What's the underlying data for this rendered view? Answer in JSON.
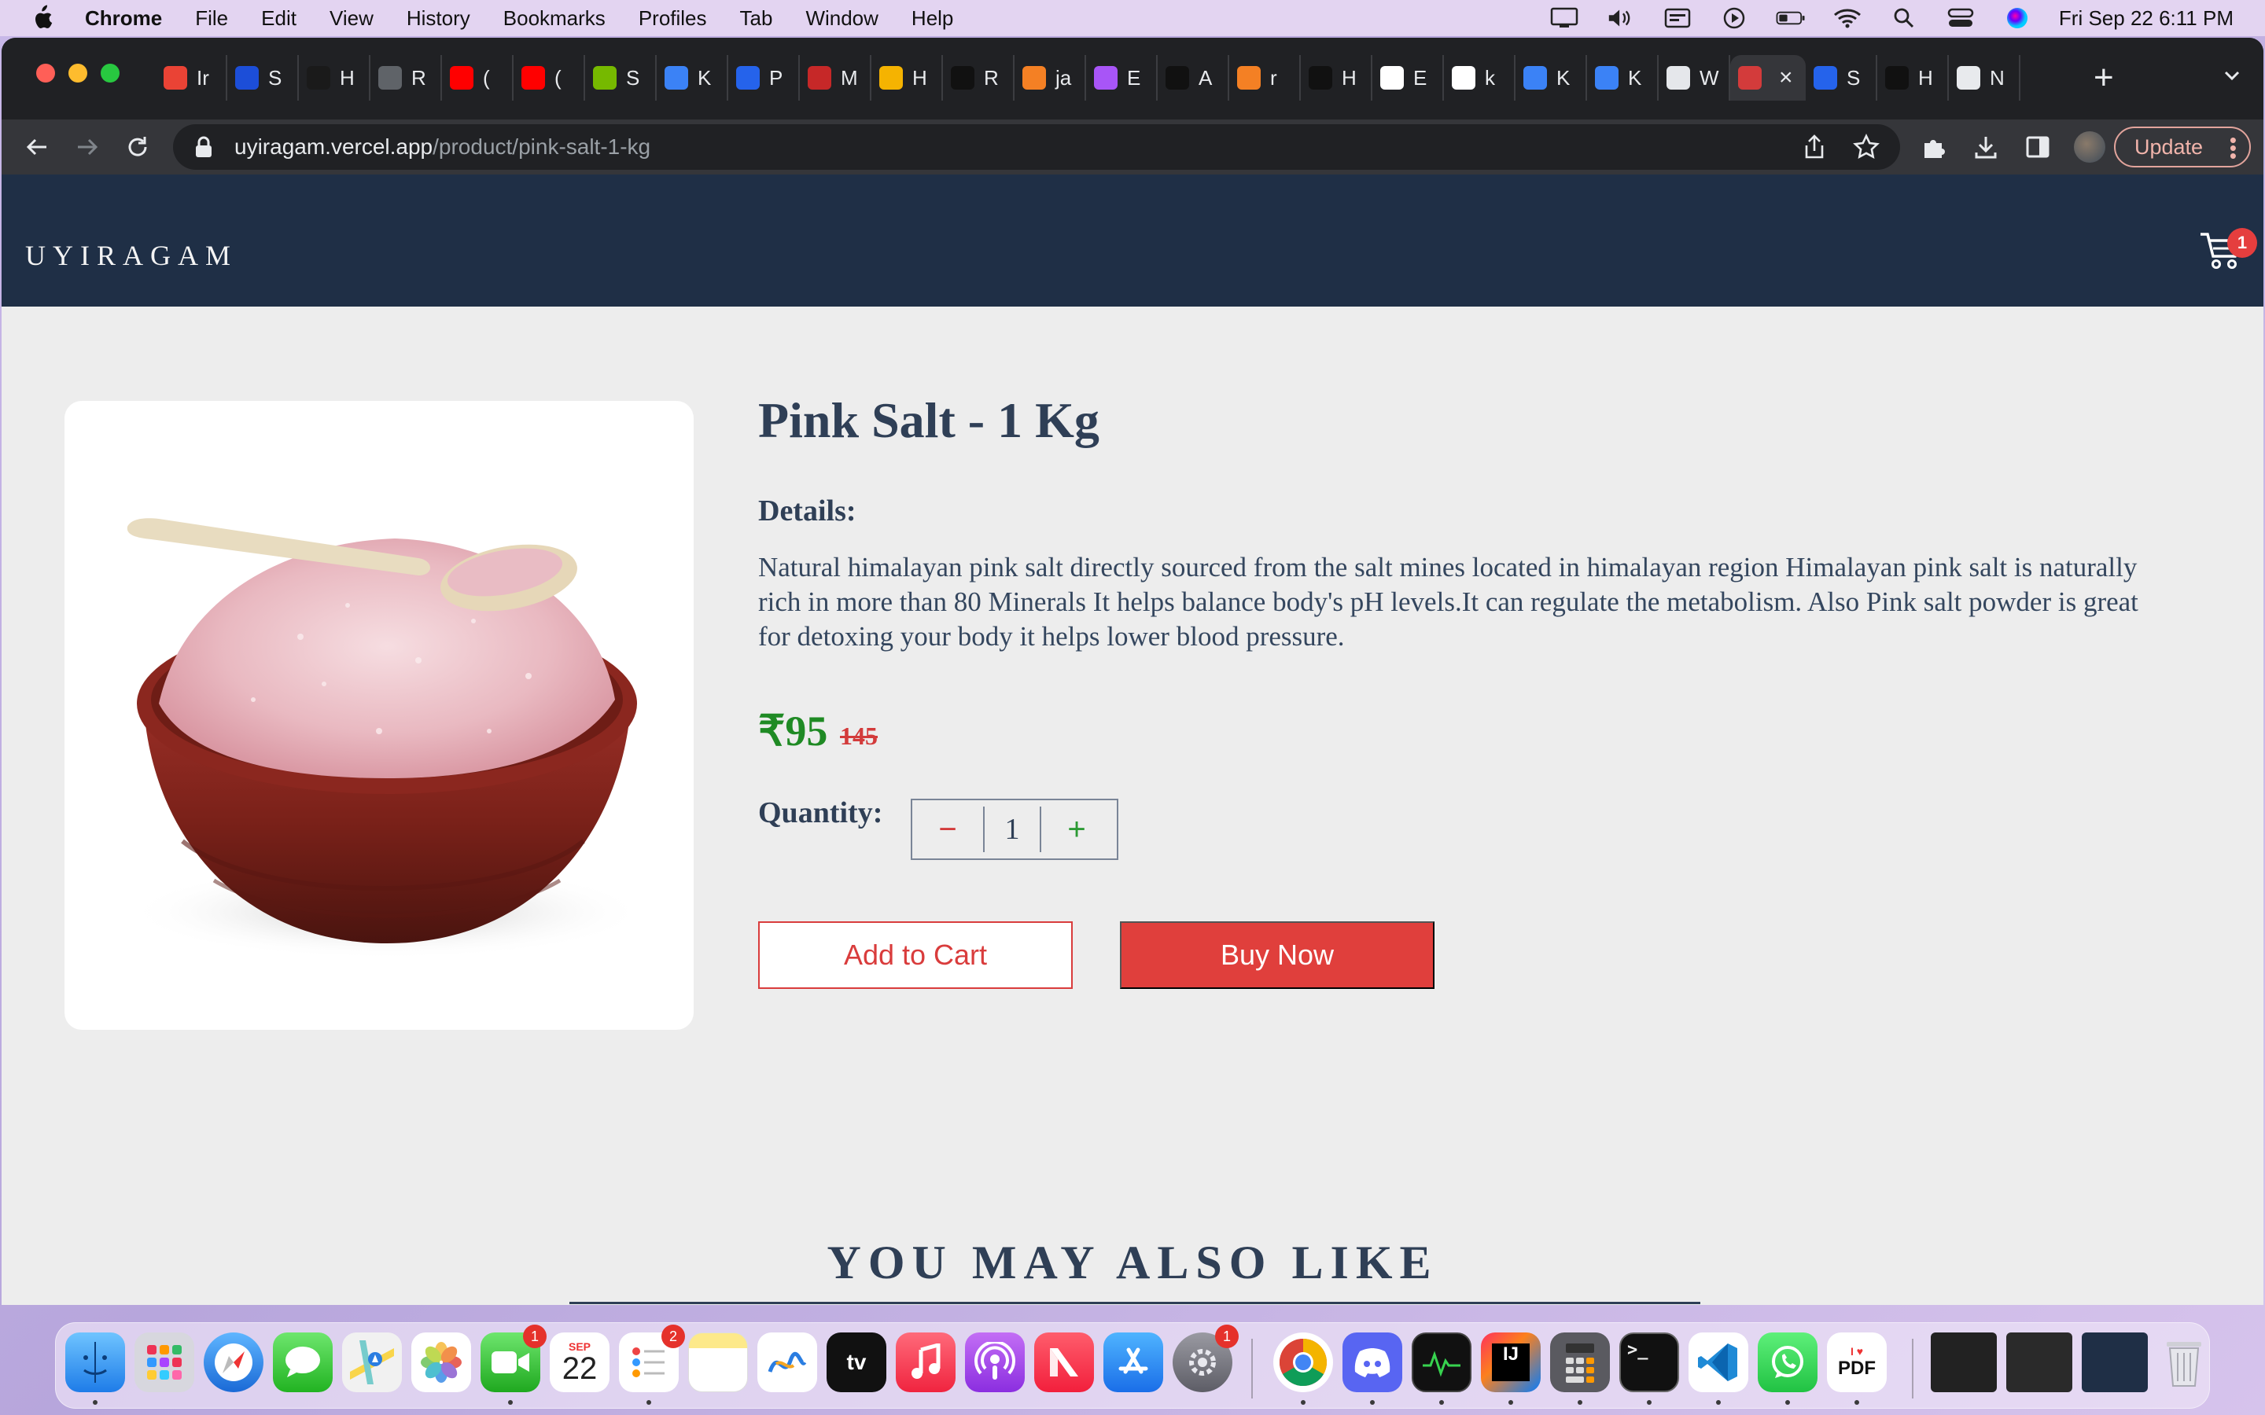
{
  "menubar": {
    "app_name": "Chrome",
    "items": [
      "File",
      "Edit",
      "View",
      "History",
      "Bookmarks",
      "Profiles",
      "Tab",
      "Window",
      "Help"
    ],
    "clock": "Fri Sep 22  6:11 PM"
  },
  "browser": {
    "tabs": [
      {
        "letter": "Ir",
        "icon": "gmail-icon",
        "color": "#ea4335"
      },
      {
        "letter": "S",
        "icon": "unstop-icon",
        "color": "#1c4ed8"
      },
      {
        "letter": "H",
        "icon": "hackerearth-icon",
        "color": "#1a1a1a"
      },
      {
        "letter": "R",
        "icon": "globe-icon",
        "color": "#5f6368"
      },
      {
        "letter": "(",
        "icon": "youtube-icon",
        "color": "#ff0000"
      },
      {
        "letter": "(",
        "icon": "youtube-icon",
        "color": "#ff0000"
      },
      {
        "letter": "S",
        "icon": "nvidia-icon",
        "color": "#76b900"
      },
      {
        "letter": "K",
        "icon": "wave-icon",
        "color": "#3b82f6"
      },
      {
        "letter": "P",
        "icon": "play-icon",
        "color": "#2563eb"
      },
      {
        "letter": "M",
        "icon": "m-icon",
        "color": "#c62828"
      },
      {
        "letter": "H",
        "icon": "smiley-icon",
        "color": "#f5b301"
      },
      {
        "letter": "R",
        "icon": "dumbbell-icon",
        "color": "#111111"
      },
      {
        "letter": "ja",
        "icon": "stackoverflow-icon",
        "color": "#f48024"
      },
      {
        "letter": "E",
        "icon": "vite-icon",
        "color": "#a855f7"
      },
      {
        "letter": "A",
        "icon": "triangle-icon",
        "color": "#111111"
      },
      {
        "letter": "r",
        "icon": "stackoverflow-icon",
        "color": "#f48024"
      },
      {
        "letter": "H",
        "icon": "medium-icon",
        "color": "#111111"
      },
      {
        "letter": "E",
        "icon": "w3schools-icon",
        "color": "#ffffff"
      },
      {
        "letter": "k",
        "icon": "github-icon",
        "color": "#ffffff"
      },
      {
        "letter": "K",
        "icon": "wave-icon",
        "color": "#3b82f6"
      },
      {
        "letter": "K",
        "icon": "wave-icon",
        "color": "#3b82f6"
      },
      {
        "letter": "W",
        "icon": "wellfound-icon",
        "color": "#e5e7eb"
      },
      {
        "letter": "",
        "icon": "uyiragam-icon",
        "color": "#d33b3b",
        "active": true
      },
      {
        "letter": "S",
        "icon": "globe-blue-icon",
        "color": "#2563eb"
      },
      {
        "letter": "H",
        "icon": "medium-icon",
        "color": "#111111"
      },
      {
        "letter": "N",
        "icon": "chrome-icon",
        "color": "#e8eaed"
      }
    ],
    "url_host": "uyiragam.vercel.app",
    "url_path": "/product/pink-salt-1-kg",
    "update_label": "Update"
  },
  "site": {
    "logo": "UYIRAGAM",
    "cart_count": "1"
  },
  "product": {
    "title": "Pink Salt - 1 Kg",
    "details_label": "Details:",
    "description": "Natural himalayan pink salt directly sourced from the salt mines located in himalayan region Himalayan pink salt is naturally rich in more than 80 Minerals It helps balance body's pH levels.It can regulate the metabolism. Also Pink salt powder is great for detoxing your body it helps lower blood pressure.",
    "price": "₹95",
    "mrp": "145",
    "quantity_label": "Quantity:",
    "quantity_minus": "−",
    "quantity": "1",
    "quantity_plus": "+",
    "add_to_cart": "Add to Cart",
    "buy_now": "Buy Now"
  },
  "related": {
    "heading": "YOU MAY ALSO LIKE"
  },
  "dock": {
    "calendar_month": "SEP",
    "calendar_day": "22",
    "facetime_badge": "1",
    "reminders_badge": "2",
    "settings_badge": "1",
    "intellij_label": "IJ",
    "terminal_label": ">_",
    "pdf_label": "PDF",
    "tv_label": "tv"
  }
}
